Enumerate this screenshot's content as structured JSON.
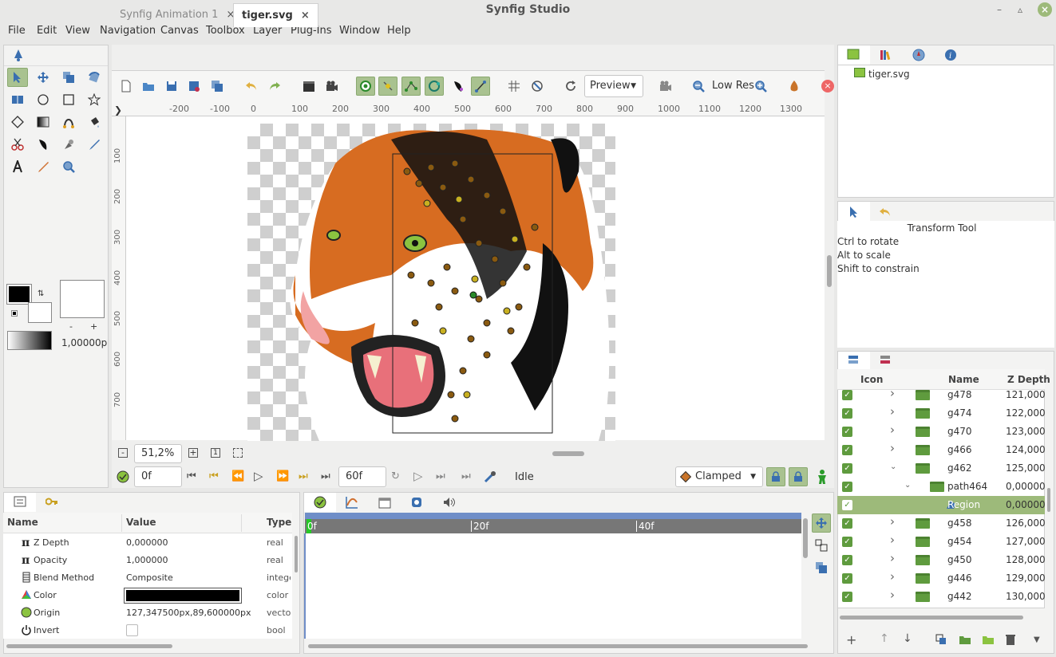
{
  "app_title": "Synfig Studio",
  "menu": [
    "File",
    "Edit",
    "View",
    "Navigation",
    "Canvas",
    "Toolbox",
    "Layer",
    "Plug-Ins",
    "Window",
    "Help"
  ],
  "tabs": [
    {
      "label": "Synfig Animation 1",
      "active": false
    },
    {
      "label": "tiger.svg",
      "active": true
    }
  ],
  "toolbar": {
    "preview_label": "Preview",
    "lowres_label": "Low Res"
  },
  "ruler_h": [
    "-200",
    "-100",
    "0",
    "100",
    "200",
    "300",
    "400",
    "500",
    "600",
    "700",
    "800",
    "900",
    "1000",
    "1100",
    "1200",
    "1300"
  ],
  "ruler_v": [
    "100",
    "200",
    "300",
    "400",
    "500",
    "600",
    "700"
  ],
  "zoom": "51,2%",
  "time_current": "0f",
  "time_end": "60f",
  "status": "Idle",
  "interpolation": "Clamped",
  "toolbox": {
    "brush_size": "1,00000p",
    "minus": "-",
    "plus": "+"
  },
  "canvas_browser": {
    "item": "tiger.svg"
  },
  "tool_options": {
    "title": "Transform Tool",
    "lines": [
      "Ctrl to rotate",
      "Alt to scale",
      "Shift to constrain"
    ]
  },
  "layers": {
    "headers": [
      "Icon",
      "Name",
      "Z Depth"
    ],
    "rows": [
      {
        "name": "g478",
        "depth": "121,0000",
        "indent": 0,
        "expanded": false,
        "type": "folder",
        "partial": true
      },
      {
        "name": "g474",
        "depth": "122,0000",
        "indent": 0,
        "expanded": false,
        "type": "folder"
      },
      {
        "name": "g470",
        "depth": "123,0000",
        "indent": 0,
        "expanded": false,
        "type": "folder"
      },
      {
        "name": "g466",
        "depth": "124,0000",
        "indent": 0,
        "expanded": false,
        "type": "folder"
      },
      {
        "name": "g462",
        "depth": "125,0000",
        "indent": 0,
        "expanded": true,
        "type": "folder"
      },
      {
        "name": "path464",
        "depth": "0,000000",
        "indent": 1,
        "expanded": true,
        "type": "folder"
      },
      {
        "name": "Region",
        "depth": "0,000000",
        "indent": 2,
        "expanded": false,
        "type": "region",
        "selected": true
      },
      {
        "name": "g458",
        "depth": "126,0000",
        "indent": 0,
        "expanded": false,
        "type": "folder"
      },
      {
        "name": "g454",
        "depth": "127,0000",
        "indent": 0,
        "expanded": false,
        "type": "folder"
      },
      {
        "name": "g450",
        "depth": "128,0000",
        "indent": 0,
        "expanded": false,
        "type": "folder"
      },
      {
        "name": "g446",
        "depth": "129,0000",
        "indent": 0,
        "expanded": false,
        "type": "folder"
      },
      {
        "name": "g442",
        "depth": "130,0000",
        "indent": 0,
        "expanded": false,
        "type": "folder"
      }
    ]
  },
  "params": {
    "headers": [
      "Name",
      "Value",
      "Type"
    ],
    "rows": [
      {
        "name": "Z Depth",
        "value": "0,000000",
        "type": "real",
        "icon": "pi"
      },
      {
        "name": "Opacity",
        "value": "1,000000",
        "type": "real",
        "icon": "pi"
      },
      {
        "name": "Blend Method",
        "value": "Composite",
        "type": "intege",
        "icon": "blend"
      },
      {
        "name": "Color",
        "value": "",
        "type": "color",
        "icon": "color"
      },
      {
        "name": "Origin",
        "value": "127,347500px,89,600000px",
        "type": "vector",
        "icon": "origin"
      },
      {
        "name": "Invert",
        "value": "",
        "type": "bool",
        "icon": "power"
      }
    ]
  },
  "timetrack": {
    "marks": [
      "0f",
      "20f",
      "40f"
    ]
  },
  "colors": {
    "accent": "#a9c290",
    "green": "#5f9b3e",
    "selected_row": "#9dba7a"
  }
}
